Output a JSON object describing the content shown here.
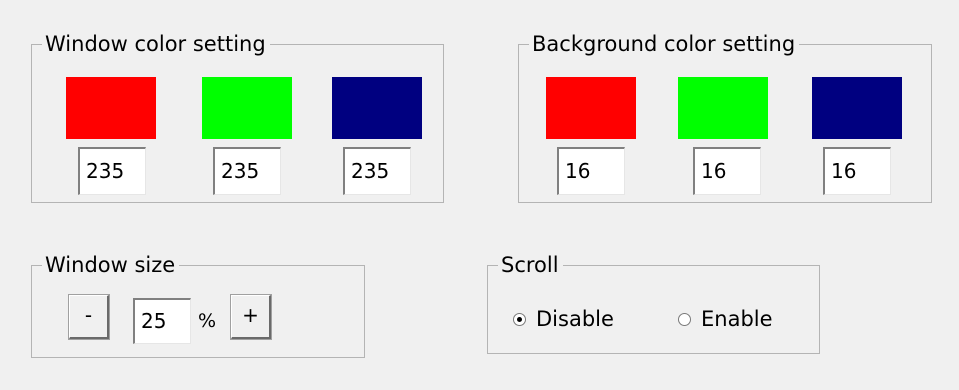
{
  "window_color": {
    "title": "Window color setting",
    "red": {
      "color": "#ff0000",
      "value": "235"
    },
    "green": {
      "color": "#00ff00",
      "value": "235"
    },
    "blue": {
      "color": "#000080",
      "value": "235"
    }
  },
  "background_color": {
    "title": "Background color setting",
    "red": {
      "color": "#ff0000",
      "value": "16"
    },
    "green": {
      "color": "#00ff00",
      "value": "16"
    },
    "blue": {
      "color": "#000080",
      "value": "16"
    }
  },
  "window_size": {
    "title": "Window size",
    "decrease_label": "-",
    "value": "25",
    "unit": "%",
    "increase_label": "+"
  },
  "scroll": {
    "title": "Scroll",
    "options": [
      {
        "label": "Disable",
        "selected": true
      },
      {
        "label": "Enable",
        "selected": false
      }
    ]
  }
}
